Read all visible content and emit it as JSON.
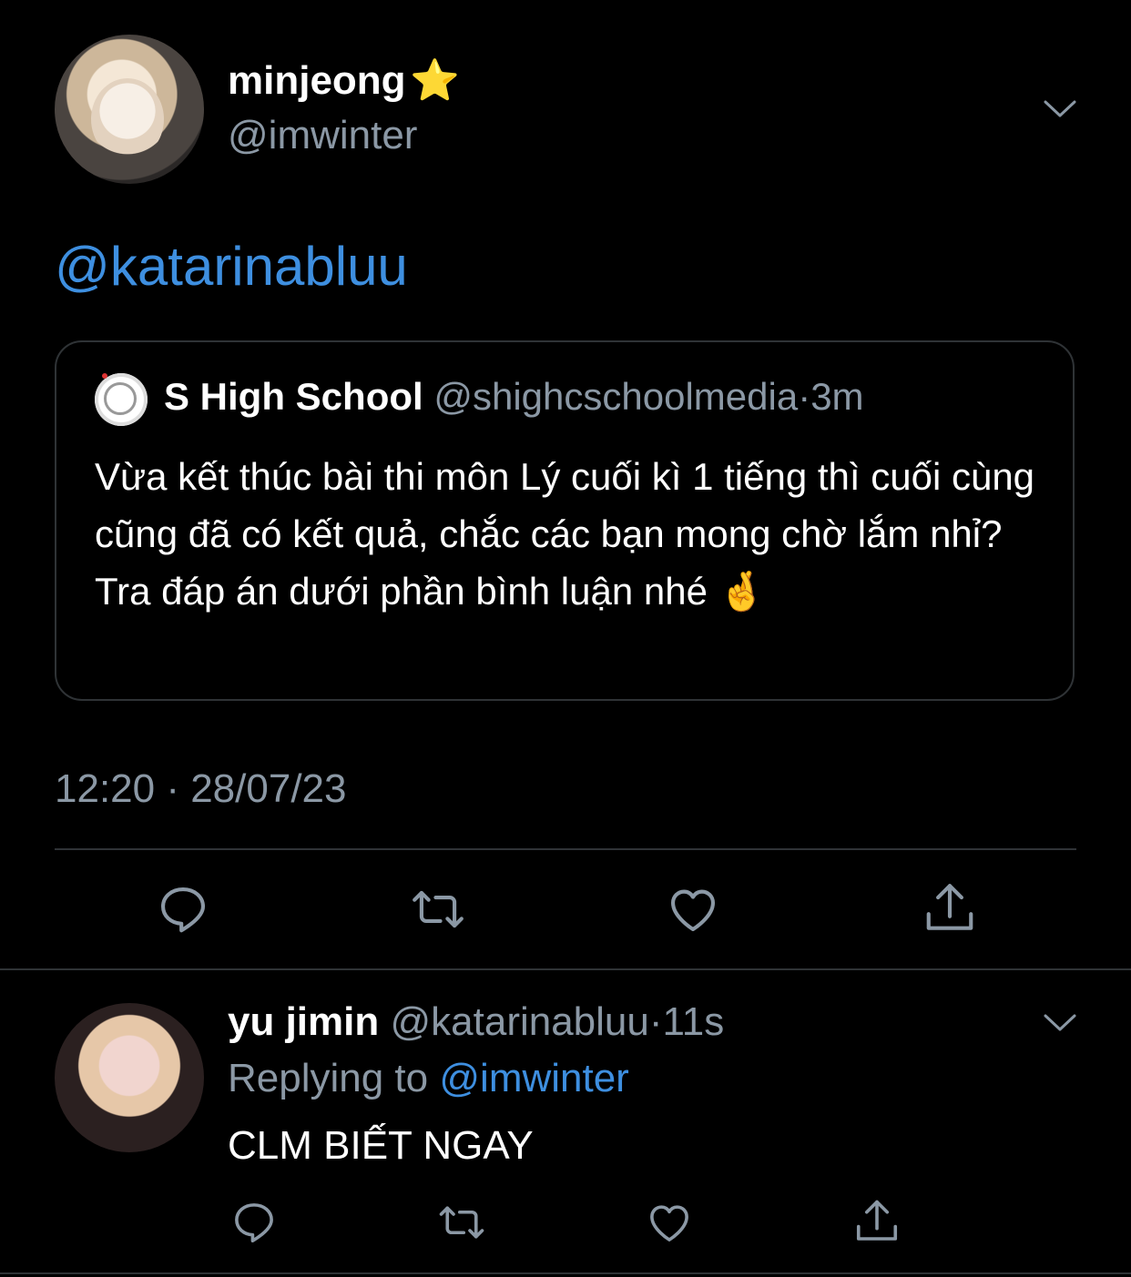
{
  "main_tweet": {
    "author_name": "minjeong",
    "author_badge": "⭐",
    "author_handle": "@imwinter",
    "mention": "@katarinabluu",
    "timestamp": "12:20 · 28/07/23"
  },
  "quoted_tweet": {
    "author_name": "S High School",
    "author_handle": "@shighcschoolmedia",
    "separator": "·",
    "age": "3m",
    "text": "Vừa kết thúc bài thi môn Lý cuối kì 1 tiếng thì cuối cùng cũng đã có kết quả, chắc các bạn mong chờ lắm nhỉ? Tra đáp án dưới phần bình luận nhé 🤞"
  },
  "reply": {
    "author_name": "yu jimin",
    "author_handle": "@katarinabluu",
    "separator": "·",
    "age": "11s",
    "replying_prefix": "Replying to",
    "replying_to": "@imwinter",
    "text": "CLM BIẾT NGAY"
  },
  "icons": [
    "chevron-down-icon",
    "reply-icon",
    "retweet-icon",
    "like-icon",
    "share-icon"
  ],
  "colors": {
    "background": "#000000",
    "link": "#3e8fe0",
    "secondary_text": "#8b98a5",
    "divider": "#2f3336",
    "icon": "#8b98a5"
  }
}
